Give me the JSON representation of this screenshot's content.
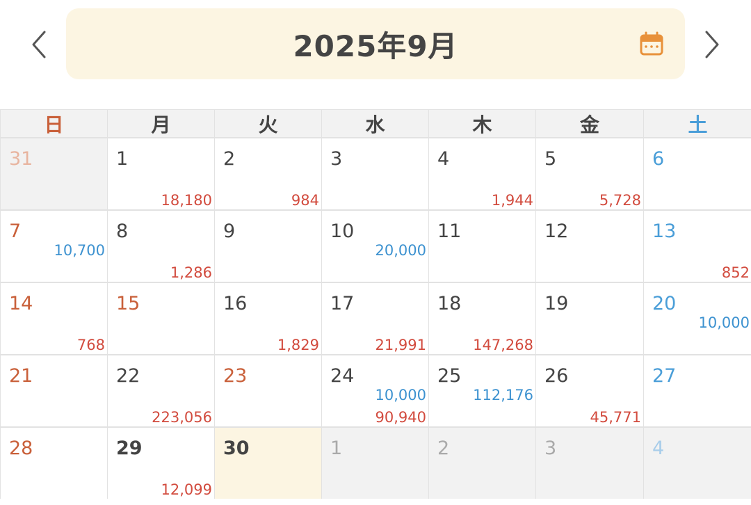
{
  "header": {
    "title": "2025年9月",
    "prev_icon": "chevron-left-icon",
    "next_icon": "chevron-right-icon",
    "calendar_icon": "calendar-icon"
  },
  "colors": {
    "sunday": "#c9603a",
    "saturday": "#4a9ed8",
    "income": "#3d92d0",
    "expense": "#d24b3e",
    "header_bg": "#fcf5e2",
    "calendar_icon": "#e8913a"
  },
  "weekdays": [
    "日",
    "月",
    "火",
    "水",
    "木",
    "金",
    "土"
  ],
  "days": [
    {
      "d": "31",
      "other": true,
      "income": "",
      "expense": ""
    },
    {
      "d": "1",
      "income": "",
      "expense": "18,180"
    },
    {
      "d": "2",
      "income": "",
      "expense": "984"
    },
    {
      "d": "3",
      "income": "",
      "expense": ""
    },
    {
      "d": "4",
      "income": "",
      "expense": "1,944"
    },
    {
      "d": "5",
      "income": "",
      "expense": "5,728"
    },
    {
      "d": "6",
      "income": "",
      "expense": ""
    },
    {
      "d": "7",
      "income": "10,700",
      "expense": ""
    },
    {
      "d": "8",
      "income": "",
      "expense": "1,286"
    },
    {
      "d": "9",
      "income": "",
      "expense": ""
    },
    {
      "d": "10",
      "income": "20,000",
      "expense": ""
    },
    {
      "d": "11",
      "income": "",
      "expense": ""
    },
    {
      "d": "12",
      "income": "",
      "expense": ""
    },
    {
      "d": "13",
      "income": "",
      "expense": "852"
    },
    {
      "d": "14",
      "income": "",
      "expense": "768"
    },
    {
      "d": "15",
      "holiday": true,
      "income": "",
      "expense": ""
    },
    {
      "d": "16",
      "income": "",
      "expense": "1,829"
    },
    {
      "d": "17",
      "income": "",
      "expense": "21,991"
    },
    {
      "d": "18",
      "income": "",
      "expense": "147,268"
    },
    {
      "d": "19",
      "income": "",
      "expense": ""
    },
    {
      "d": "20",
      "income": "10,000",
      "expense": ""
    },
    {
      "d": "21",
      "income": "",
      "expense": ""
    },
    {
      "d": "22",
      "income": "",
      "expense": "223,056"
    },
    {
      "d": "23",
      "holiday": true,
      "income": "",
      "expense": ""
    },
    {
      "d": "24",
      "income": "10,000",
      "expense": "90,940"
    },
    {
      "d": "25",
      "income": "112,176",
      "expense": ""
    },
    {
      "d": "26",
      "income": "",
      "expense": "45,771"
    },
    {
      "d": "27",
      "income": "",
      "expense": ""
    },
    {
      "d": "28",
      "income": "",
      "expense": ""
    },
    {
      "d": "29",
      "bold": true,
      "income": "",
      "expense": "12,099"
    },
    {
      "d": "30",
      "bold": true,
      "today": true,
      "income": "",
      "expense": ""
    },
    {
      "d": "1",
      "other": true,
      "income": "",
      "expense": ""
    },
    {
      "d": "2",
      "other": true,
      "income": "",
      "expense": ""
    },
    {
      "d": "3",
      "other": true,
      "income": "",
      "expense": ""
    },
    {
      "d": "4",
      "other": true,
      "income": "",
      "expense": ""
    }
  ]
}
